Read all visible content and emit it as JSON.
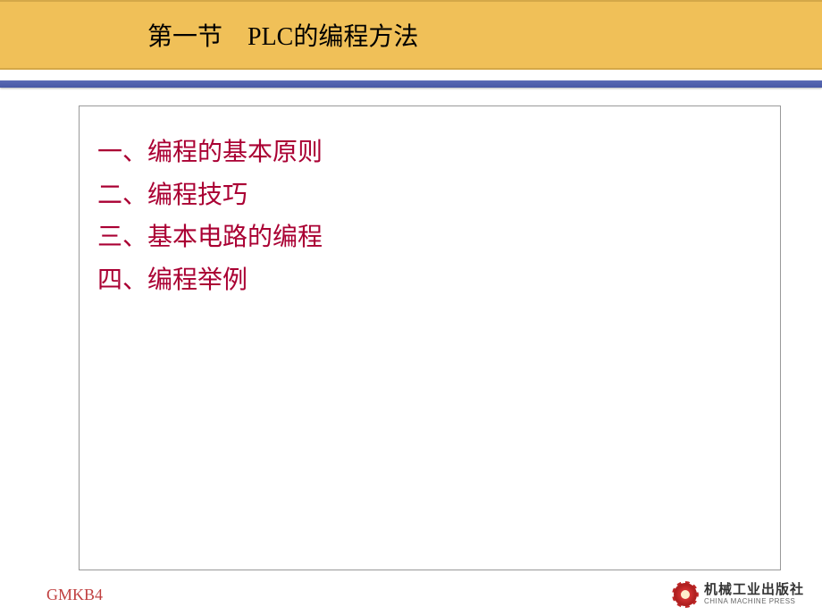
{
  "header": {
    "title": "第一节　PLC的编程方法"
  },
  "content": {
    "items": [
      "一、编程的基本原则",
      "二、编程技巧",
      "三、基本电路的编程",
      "四、编程举例"
    ]
  },
  "footer": {
    "left_code": "GMKB4",
    "publisher_cn": "机械工业出版社",
    "publisher_en": "CHINA MACHINE PRESS"
  }
}
